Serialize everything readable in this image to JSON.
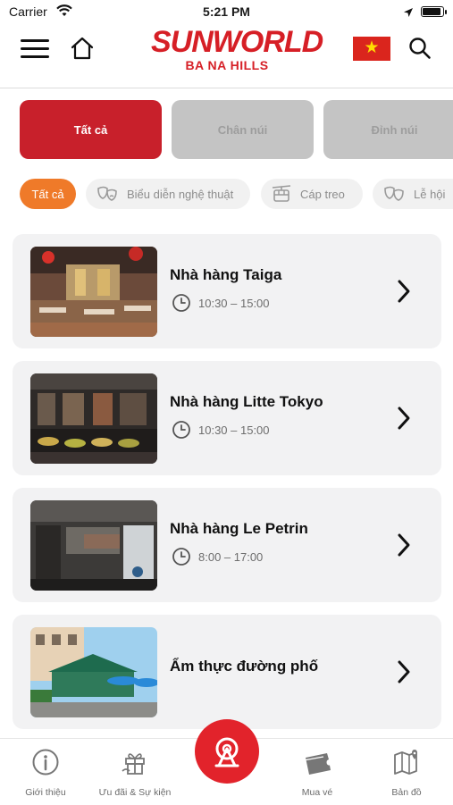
{
  "status_bar": {
    "carrier": "Carrier",
    "time": "5:21 PM"
  },
  "header": {
    "logo_main": "SUNWORLD",
    "logo_sub": "BA NA HILLS",
    "flag_icon": "vietnam-flag-icon",
    "icons": [
      "menu-icon",
      "home-icon",
      "search-icon"
    ]
  },
  "location_tabs": [
    {
      "label": "Tất cả",
      "active": true
    },
    {
      "label": "Chân núi",
      "active": false
    },
    {
      "label": "Đỉnh núi",
      "active": false
    }
  ],
  "category_chips": [
    {
      "label": "Tất cả",
      "active": true,
      "icon": ""
    },
    {
      "label": "Biểu diễn nghệ thuật",
      "active": false,
      "icon": "theater-masks-icon"
    },
    {
      "label": "Cáp treo",
      "active": false,
      "icon": "cable-car-icon"
    },
    {
      "label": "Lễ hội",
      "active": false,
      "icon": "festival-masks-icon"
    }
  ],
  "restaurants": [
    {
      "name": "Nhà hàng Taiga",
      "hours": "10:30 – 15:00"
    },
    {
      "name": "Nhà hàng Litte Tokyo",
      "hours": "10:30 – 15:00"
    },
    {
      "name": "Nhà hàng Le Petrin",
      "hours": "8:00 – 17:00"
    },
    {
      "name": "Ẩm thực đường phố",
      "hours": ""
    }
  ],
  "tab_bar": {
    "items": [
      {
        "label": "Giới thiệu",
        "icon": "info-icon"
      },
      {
        "label": "Ưu đãi & Sự kiện",
        "icon": "gift-icon"
      },
      {
        "label": "Mua vé",
        "icon": "ticket-icon"
      },
      {
        "label": "Bản đồ",
        "icon": "map-icon"
      }
    ],
    "center_icon": "ferris-wheel-icon"
  },
  "colors": {
    "brand_red": "#d61f26",
    "tab_active": "#c8202b",
    "chip_active": "#ef7a29",
    "card_bg": "#f2f2f3"
  }
}
